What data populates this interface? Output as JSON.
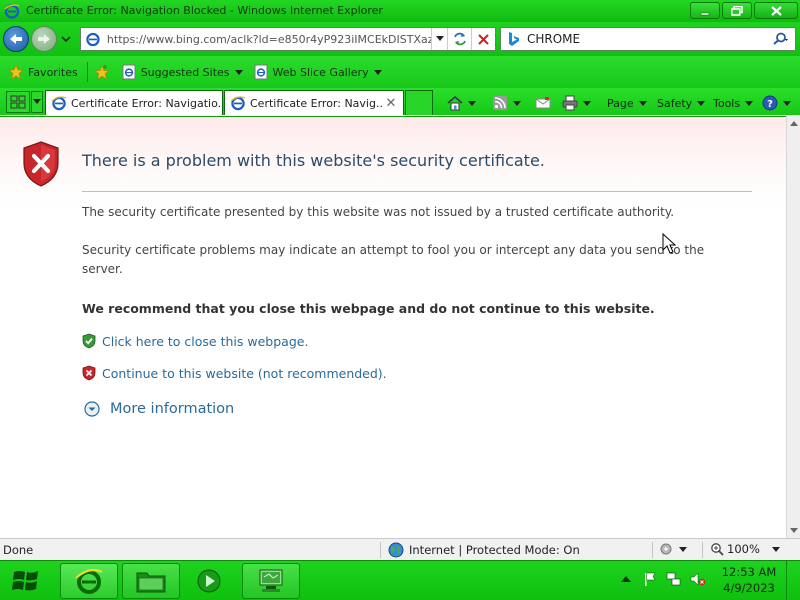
{
  "window": {
    "title": "Certificate Error: Navigation Blocked - Windows Internet Explorer"
  },
  "address_bar": {
    "url": "https://www.bing.com/aclk?ld=e850r4yP923iIMCEkDISTXaz\\"
  },
  "search": {
    "value": "CHROME"
  },
  "favorites_bar": {
    "favorites_label": "Favorites",
    "suggested_sites_label": "Suggested Sites",
    "web_slice_label": "Web Slice Gallery"
  },
  "tabs": [
    {
      "label": "Certificate Error: Navigatio..."
    },
    {
      "label": "Certificate Error: Navig..."
    }
  ],
  "command_bar": {
    "page_label": "Page",
    "safety_label": "Safety",
    "tools_label": "Tools"
  },
  "error_page": {
    "title": "There is a problem with this website's security certificate.",
    "paragraph1": "The security certificate presented by this website was not issued by a trusted certificate authority.",
    "paragraph2": "Security certificate problems may indicate an attempt to fool you or intercept any data you send to the server.",
    "recommendation": "We recommend that you close this webpage and do not continue to this website.",
    "close_link": "Click here to close this webpage.",
    "continue_link": "Continue to this website (not recommended).",
    "more_info": "More information"
  },
  "status_bar": {
    "status": "Done",
    "zone": "Internet | Protected Mode: On",
    "zoom": "100%"
  },
  "taskbar": {
    "time": "12:53 AM",
    "date": "4/9/2023"
  },
  "colors": {
    "chrome_green": "#1cd01c",
    "link_blue": "#2a6a9a",
    "title_blue": "#2a4a6a",
    "error_red": "#c8262a",
    "ok_green": "#3a9a3a"
  },
  "icons": [
    "ie-icon",
    "back-arrow-icon",
    "forward-arrow-icon",
    "refresh-icon",
    "stop-icon",
    "bing-icon",
    "search-icon",
    "star-icon",
    "add-favorite-icon",
    "quick-tabs-icon",
    "home-icon",
    "rss-icon",
    "mail-icon",
    "print-icon",
    "help-icon",
    "error-shield-icon",
    "ok-shield-icon",
    "chevron-down-circle-icon",
    "globe-icon",
    "zoom-icon",
    "windows-logo-icon",
    "folder-icon",
    "media-player-icon",
    "network-icon",
    "flag-icon",
    "volume-muted-icon"
  ]
}
